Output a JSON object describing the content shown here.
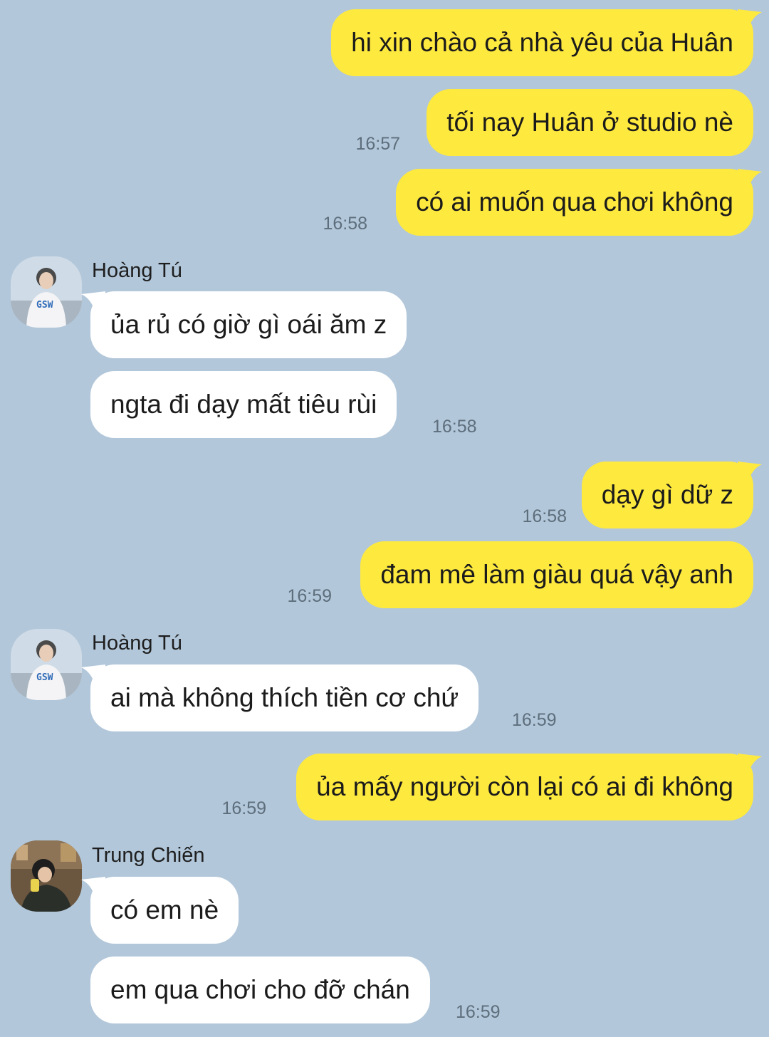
{
  "messages": [
    {
      "side": "me",
      "text": "hi xin chào cả nhà yêu của Huân",
      "time": ""
    },
    {
      "side": "me",
      "text": "tối nay Huân ở studio nè",
      "time": "16:57"
    },
    {
      "side": "me",
      "text": "có ai muốn qua chơi không",
      "time": "16:58"
    },
    {
      "side": "them",
      "sender": "Hoàng Tú",
      "text": "ủa rủ có giờ gì oái ăm z",
      "time": ""
    },
    {
      "side": "them",
      "text": "ngta đi dạy mất tiêu rùi",
      "time": "16:58"
    },
    {
      "side": "me",
      "text": "dạy gì dữ z",
      "time": "16:58"
    },
    {
      "side": "me",
      "text": "đam mê làm giàu quá vậy anh",
      "time": "16:59"
    },
    {
      "side": "them",
      "sender": "Hoàng Tú",
      "text": "ai mà không thích tiền cơ chứ",
      "time": "16:59"
    },
    {
      "side": "me",
      "text": "ủa mấy người còn lại có ai đi không",
      "time": "16:59"
    },
    {
      "side": "them",
      "sender": "Trung Chiến",
      "text": "có em nè",
      "time": ""
    },
    {
      "side": "them",
      "text": "em qua chơi cho đỡ chán",
      "time": "16:59"
    }
  ],
  "colors": {
    "background": "#b2c7da",
    "my_bubble": "#fee93f",
    "their_bubble": "#ffffff",
    "timestamp": "#5d6e7c"
  },
  "avatars": {
    "hoang_tu": "avatar-hoang-tu",
    "trung_chien": "avatar-trung-chien"
  }
}
